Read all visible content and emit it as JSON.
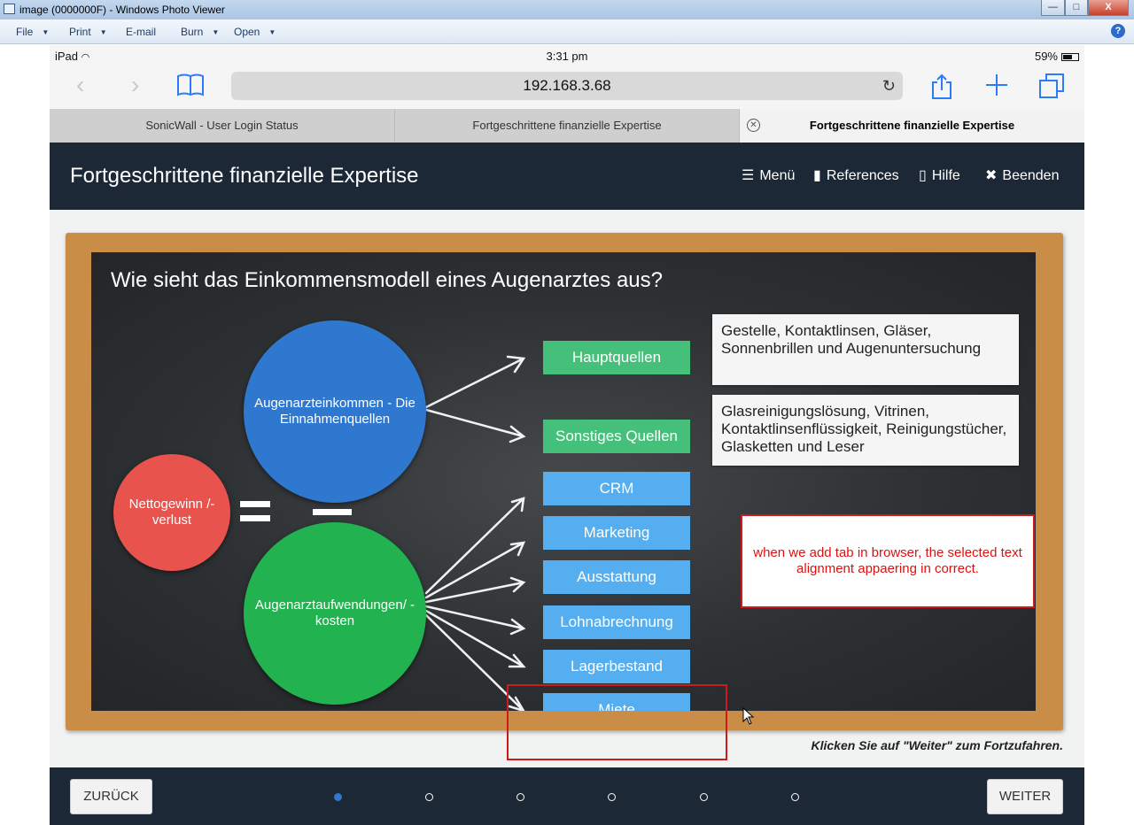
{
  "window": {
    "title": "image (0000000F) - Windows Photo Viewer",
    "controls": [
      "—",
      "□",
      "X"
    ]
  },
  "menu": {
    "file": "File",
    "print": "Print",
    "email": "E-mail",
    "burn": "Burn",
    "open": "Open",
    "help": "?"
  },
  "ipad_status": {
    "device": "iPad",
    "time": "3:31 pm",
    "battery": "59%"
  },
  "browser": {
    "url": "192.168.3.68",
    "tabs": [
      {
        "label": "SonicWall - User Login Status"
      },
      {
        "label": "Fortgeschrittene finanzielle Expertise"
      },
      {
        "label": "Fortgeschrittene finanzielle Expertise"
      }
    ]
  },
  "app": {
    "title": "Fortgeschrittene finanzielle Expertise",
    "nav": {
      "menu": "Menü",
      "references": "References",
      "help": "Hilfe",
      "exit": "Beenden"
    }
  },
  "slide": {
    "question": "Wie sieht das Einkommensmodell eines Augenarztes aus?",
    "net": "Nettogewinn /-verlust",
    "income": "Augenarzteinkommen - Die Einnahmenquellen",
    "expenses": "Augenarztaufwendungen/ -kosten",
    "income_boxes": [
      "Hauptquellen",
      "Sonstiges Quellen"
    ],
    "expense_boxes": [
      "CRM",
      "Marketing",
      "Ausstattung",
      "Lohnabrechnung",
      "Lagerbestand",
      "Miete"
    ],
    "notes": [
      "Gestelle, Kontaktlinsen, Gläser, Sonnenbrillen und Augenuntersuchung",
      "Glasreinigungslösung, Vitrinen, Kontaktlinsenflüssigkeit, Reinigungstücher, Glasketten und Leser"
    ],
    "hint": "Klicken Sie auf \"Weiter\" zum Fortzufahren."
  },
  "footer": {
    "back": "ZURÜCK",
    "next": "WEITER",
    "dots_total": 6,
    "dots_active": 1
  },
  "annotation": {
    "text": "when we add tab in browser, the selected text alignment appaering in correct."
  },
  "colors": {
    "header_bg": "#1d2836",
    "annotation_red": "#cc1b1b",
    "circle_red": "#e9534d",
    "circle_blue": "#2f78cf",
    "circle_green": "#22b24f",
    "box_green": "#45c07a",
    "box_blue": "#54aef0"
  }
}
